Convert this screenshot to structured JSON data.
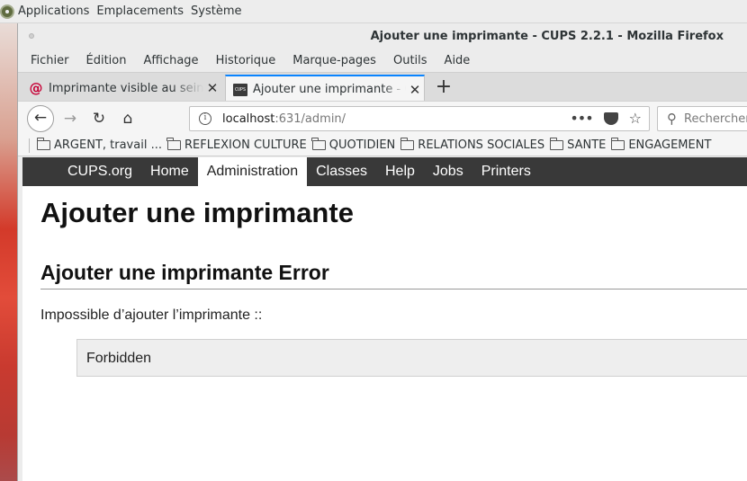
{
  "desktop": {
    "menus": [
      "Applications",
      "Emplacements",
      "Système"
    ]
  },
  "window": {
    "title": "Ajouter une imprimante - CUPS 2.2.1 - Mozilla Firefox"
  },
  "menubar": {
    "items": [
      "Fichier",
      "Édition",
      "Affichage",
      "Historique",
      "Marque-pages",
      "Outils",
      "Aide"
    ]
  },
  "tabs": [
    {
      "label": "Imprimante visible au sein",
      "icon": "debian-icon"
    },
    {
      "label": "Ajouter une imprimante - C",
      "icon": "cups-icon",
      "active": true
    }
  ],
  "navbar": {
    "url_host": "localhost",
    "url_rest": ":631/admin/",
    "search_placeholder": "Rechercher"
  },
  "bookmarks": [
    "ARGENT, travail ...",
    "REFLEXION CULTURE",
    "QUOTIDIEN",
    "RELATIONS SOCIALES",
    "SANTE",
    "ENGAGEMENT"
  ],
  "cups": {
    "nav": [
      "CUPS.org",
      "Home",
      "Administration",
      "Classes",
      "Help",
      "Jobs",
      "Printers"
    ],
    "active_nav": "Administration",
    "page_title": "Ajouter une imprimante",
    "section_title": "Ajouter une imprimante Error",
    "error_message": "Impossible d’ajouter l’imprimante ::",
    "error_detail": "Forbidden"
  }
}
